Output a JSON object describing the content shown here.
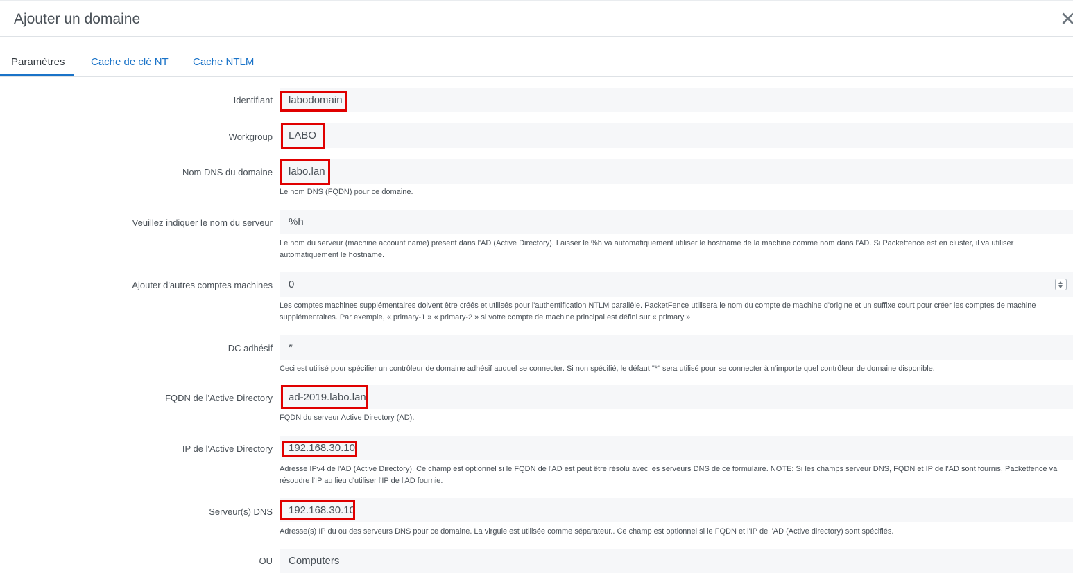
{
  "modal": {
    "title": "Ajouter un domaine",
    "close_label": "✕"
  },
  "tabs": [
    {
      "label": "Paramètres",
      "active": true
    },
    {
      "label": "Cache de clé NT",
      "active": false
    },
    {
      "label": "Cache NTLM",
      "active": false
    }
  ],
  "form": {
    "identifiant": {
      "label": "Identifiant",
      "value": "labodomain"
    },
    "workgroup": {
      "label": "Workgroup",
      "value": "LABO"
    },
    "dns_name": {
      "label": "Nom DNS du domaine",
      "value": "labo.lan",
      "help": "Le nom DNS (FQDN) pour ce domaine."
    },
    "server_name": {
      "label": "Veuillez indiquer le nom du serveur",
      "value": "%h",
      "help": "Le nom du serveur (machine account name) présent dans l'AD (Active Directory). Laisser le %h va automatiquement utiliser le hostname de la machine comme nom dans l'AD. Si Packetfence est en cluster, il va utiliser automatiquement le hostname."
    },
    "extra_accounts": {
      "label": "Ajouter d'autres comptes machines",
      "value": "0",
      "help": "Les comptes machines supplémentaires doivent être créés et utilisés pour l'authentification NTLM parallèle. PacketFence utilisera le nom du compte de machine d'origine et un suffixe court pour créer les comptes de machine supplémentaires. Par exemple, « primary-1 » « primary-2 » si votre compte de machine principal est défini sur « primary »"
    },
    "sticky_dc": {
      "label": "DC adhésif",
      "value": "*",
      "help": "Ceci est utilisé pour spécifier un contrôleur de domaine adhésif auquel se connecter. Si non spécifié, le défaut \"*\" sera utilisé pour se connecter à n'importe quel contrôleur de domaine disponible."
    },
    "ad_fqdn": {
      "label": "FQDN de l'Active Directory",
      "value": "ad-2019.labo.lan",
      "help": "FQDN du serveur Active Directory (AD)."
    },
    "ad_ip": {
      "label": "IP de l'Active Directory",
      "value": "192.168.30.10",
      "help": "Adresse IPv4 de l'AD (Active Directory). Ce champ est optionnel si le FQDN de l'AD est peut être résolu avec les serveurs DNS de ce formulaire. NOTE: Si les champs serveur DNS, FQDN et IP de l'AD sont fournis, Packetfence va résoudre l'IP au lieu d'utiliser l'IP de l'AD fournie."
    },
    "dns_servers": {
      "label": "Serveur(s) DNS",
      "value": "192.168.30.10",
      "help": "Adresse(s) IP du ou des serveurs DNS pour ce domaine. La virgule est utilisée comme séparateur.. Ce champ est optionnel si le FQDN et l'IP de l'AD (Active directory) sont spécifiés."
    },
    "ou": {
      "label": "OU",
      "value": "Computers"
    }
  },
  "colors": {
    "accent": "#1a73c8",
    "highlight": "#e00000",
    "input_bg": "#f6f7f9"
  }
}
